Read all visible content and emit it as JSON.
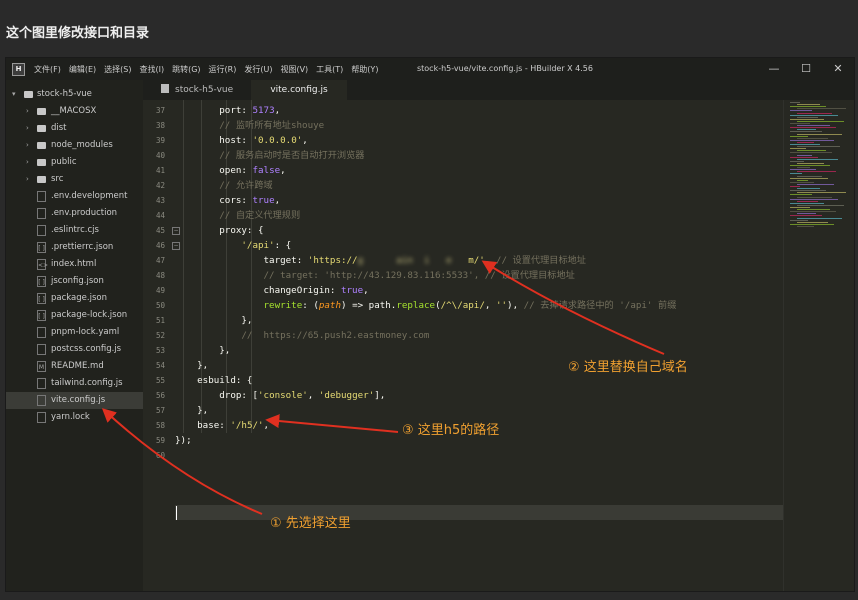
{
  "page_title": "这个图里修改接口和目录",
  "window": {
    "title": "stock-h5-vue/vite.config.js - HBuilder X 4.56",
    "app_icon": "H",
    "menu": [
      "文件(F)",
      "编辑(E)",
      "选择(S)",
      "查找(I)",
      "跳转(G)",
      "运行(R)",
      "发行(U)",
      "视图(V)",
      "工具(T)",
      "帮助(Y)"
    ],
    "controls": [
      "—",
      "☐",
      "✕"
    ]
  },
  "tabs": [
    {
      "label": "stock-h5-vue",
      "active": false
    },
    {
      "label": "vite.config.js",
      "active": true
    }
  ],
  "sidebar": {
    "root": "stock-h5-vue",
    "items": [
      {
        "label": "__MACOSX",
        "type": "folder"
      },
      {
        "label": "dist",
        "type": "folder"
      },
      {
        "label": "node_modules",
        "type": "folder"
      },
      {
        "label": "public",
        "type": "folder"
      },
      {
        "label": "src",
        "type": "folder"
      },
      {
        "label": ".env.development",
        "type": "file",
        "icon": ""
      },
      {
        "label": ".env.production",
        "type": "file",
        "icon": ""
      },
      {
        "label": ".eslintrc.cjs",
        "type": "file",
        "icon": ""
      },
      {
        "label": ".prettierrc.json",
        "type": "file",
        "icon": "[ ]"
      },
      {
        "label": "index.html",
        "type": "file",
        "icon": "<>"
      },
      {
        "label": "jsconfig.json",
        "type": "file",
        "icon": "[ ]"
      },
      {
        "label": "package.json",
        "type": "file",
        "icon": "[ ]"
      },
      {
        "label": "package-lock.json",
        "type": "file",
        "icon": "[ ]"
      },
      {
        "label": "pnpm-lock.yaml",
        "type": "file",
        "icon": ""
      },
      {
        "label": "postcss.config.js",
        "type": "file",
        "icon": ""
      },
      {
        "label": "README.md",
        "type": "file",
        "icon": "M"
      },
      {
        "label": "tailwind.config.js",
        "type": "file",
        "icon": ""
      },
      {
        "label": "vite.config.js",
        "type": "file",
        "icon": "",
        "selected": true
      },
      {
        "label": "yarn.lock",
        "type": "file",
        "icon": ""
      }
    ]
  },
  "code": {
    "line_numbers": [
      "37",
      "38",
      "39",
      "40",
      "41",
      "42",
      "43",
      "44",
      "45",
      "46",
      "47",
      "48",
      "49",
      "50",
      "51",
      "52",
      "53",
      "54",
      "55",
      "56",
      "57",
      "58",
      "59",
      "60"
    ],
    "lines": [
      {
        "indent": "        ",
        "tokens": [
          {
            "t": "port: ",
            "c": "k"
          },
          {
            "t": "5173",
            "c": "n"
          },
          {
            "t": ",",
            "c": "k"
          }
        ]
      },
      {
        "indent": "        ",
        "tokens": [
          {
            "t": "// 监听所有地址shouye",
            "c": "c"
          }
        ]
      },
      {
        "indent": "        ",
        "tokens": [
          {
            "t": "host: ",
            "c": "k"
          },
          {
            "t": "'0.0.0.0'",
            "c": "s"
          },
          {
            "t": ",",
            "c": "k"
          }
        ]
      },
      {
        "indent": "        ",
        "tokens": [
          {
            "t": "// 服务启动时是否自动打开浏览器",
            "c": "c"
          }
        ]
      },
      {
        "indent": "        ",
        "tokens": [
          {
            "t": "open: ",
            "c": "k"
          },
          {
            "t": "false",
            "c": "n"
          },
          {
            "t": ",",
            "c": "k"
          }
        ]
      },
      {
        "indent": "        ",
        "tokens": [
          {
            "t": "// 允许跨域",
            "c": "c"
          }
        ]
      },
      {
        "indent": "        ",
        "tokens": [
          {
            "t": "cors: ",
            "c": "k"
          },
          {
            "t": "true",
            "c": "n"
          },
          {
            "t": ",",
            "c": "k"
          }
        ]
      },
      {
        "indent": "        ",
        "tokens": [
          {
            "t": "// 自定义代理规则",
            "c": "c"
          }
        ]
      },
      {
        "indent": "        ",
        "tokens": [
          {
            "t": "proxy: {",
            "c": "k"
          }
        ]
      },
      {
        "indent": "            ",
        "tokens": [
          {
            "t": "'/api'",
            "c": "s"
          },
          {
            "t": ": {",
            "c": "k"
          }
        ]
      },
      {
        "indent": "                ",
        "tokens": [
          {
            "t": "target: ",
            "c": "k"
          },
          {
            "t": "'https://",
            "c": "s"
          },
          {
            "t": "g      ain  i   e   ",
            "c": "blur"
          },
          {
            "t": "m/'",
            "c": "s"
          },
          {
            "t": ", ",
            "c": "k"
          },
          {
            "t": "// 设置代理目标地址",
            "c": "c"
          }
        ]
      },
      {
        "indent": "                ",
        "tokens": [
          {
            "t": "// target: 'http://43.129.83.116:5533', // 设置代理目标地址",
            "c": "c"
          }
        ]
      },
      {
        "indent": "                ",
        "tokens": [
          {
            "t": "changeOrigin: ",
            "c": "k"
          },
          {
            "t": "true",
            "c": "n"
          },
          {
            "t": ",",
            "c": "k"
          }
        ]
      },
      {
        "indent": "                ",
        "tokens": [
          {
            "t": "rewrite",
            "c": "fn"
          },
          {
            "t": ": (",
            "c": "k"
          },
          {
            "t": "path",
            "c": "pm"
          },
          {
            "t": ") => path.",
            "c": "k"
          },
          {
            "t": "replace",
            "c": "fn"
          },
          {
            "t": "(",
            "c": "k"
          },
          {
            "t": "/^\\/api/",
            "c": "rx"
          },
          {
            "t": ", ",
            "c": "k"
          },
          {
            "t": "''",
            "c": "s"
          },
          {
            "t": "), ",
            "c": "k"
          },
          {
            "t": "// 去掉请求路径中的 '/api' 前缀",
            "c": "c"
          }
        ]
      },
      {
        "indent": "            ",
        "tokens": [
          {
            "t": "},",
            "c": "k"
          }
        ]
      },
      {
        "indent": "            ",
        "tokens": [
          {
            "t": "//  https://65.push2.eastmoney.com",
            "c": "c"
          }
        ]
      },
      {
        "indent": "        ",
        "tokens": [
          {
            "t": "},",
            "c": "k"
          }
        ]
      },
      {
        "indent": "    ",
        "tokens": [
          {
            "t": "},",
            "c": "k"
          }
        ]
      },
      {
        "indent": "    ",
        "tokens": [
          {
            "t": "esbuild: {",
            "c": "k"
          }
        ]
      },
      {
        "indent": "        ",
        "tokens": [
          {
            "t": "drop: [",
            "c": "k"
          },
          {
            "t": "'console'",
            "c": "s"
          },
          {
            "t": ", ",
            "c": "k"
          },
          {
            "t": "'debugger'",
            "c": "s"
          },
          {
            "t": "],",
            "c": "k"
          }
        ]
      },
      {
        "indent": "    ",
        "tokens": [
          {
            "t": "},",
            "c": "k"
          }
        ]
      },
      {
        "indent": "    ",
        "tokens": [
          {
            "t": "base: ",
            "c": "k"
          },
          {
            "t": "'/h5/'",
            "c": "s"
          },
          {
            "t": ",",
            "c": "k"
          }
        ]
      },
      {
        "indent": "",
        "tokens": [
          {
            "t": "});",
            "c": "k"
          }
        ]
      },
      {
        "indent": "",
        "tokens": []
      }
    ]
  },
  "annotations": {
    "step1": "① 先选择这里",
    "step2": "② 这里替换自己域名",
    "step3": "③ 这里h5的路径"
  },
  "colors": {
    "accent_annotation": "#f0a030",
    "arrow": "#e03020",
    "editor_bg": "#272822",
    "sidebar_bg": "#21221d"
  }
}
